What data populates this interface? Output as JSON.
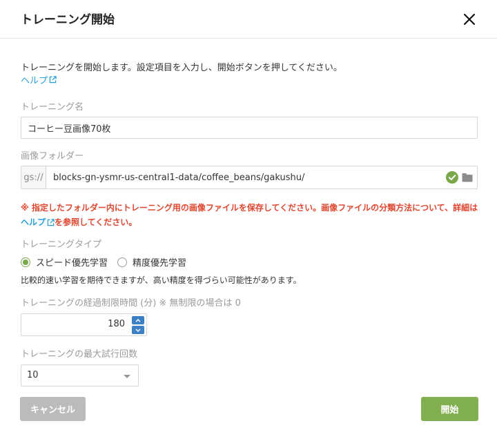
{
  "dialog": {
    "title": "トレーニング開始",
    "intro": "トレーニングを開始します。設定項目を入力し、開始ボタンを押してください。",
    "help_label": "ヘルプ"
  },
  "fields": {
    "training_name": {
      "label": "トレーニング名",
      "value": "コーヒー豆画像70枚"
    },
    "image_folder": {
      "label": "画像フォルダー",
      "prefix": "gs://",
      "value": "blocks-gn-ysmr-us-central1-data/coffee_beans/gakushu/"
    },
    "warning": {
      "part1": "※ 指定したフォルダー内にトレーニング用の画像ファイルを保存してください。画像ファイルの分類方法について、詳細は",
      "link": "ヘルプ",
      "part2": "を参照してください。"
    },
    "training_type": {
      "label": "トレーニングタイプ",
      "options": [
        "スピード優先学習",
        "精度優先学習"
      ],
      "selected": 0,
      "note": "比較的速い学習を期待できますが、高い精度を得づらい可能性があります。"
    },
    "time_limit": {
      "label": "トレーニングの経過制限時間 (分) ※ 無制限の場合は 0",
      "value": "180"
    },
    "max_trials": {
      "label": "トレーニングの最大試行回数",
      "value": "10"
    }
  },
  "buttons": {
    "cancel": "キャンセル",
    "start": "開始"
  },
  "colors": {
    "accent_green": "#82b051",
    "link_blue": "#2a9fd8",
    "warning_red": "#e0462f",
    "stepper_blue": "#3b7fc4"
  }
}
